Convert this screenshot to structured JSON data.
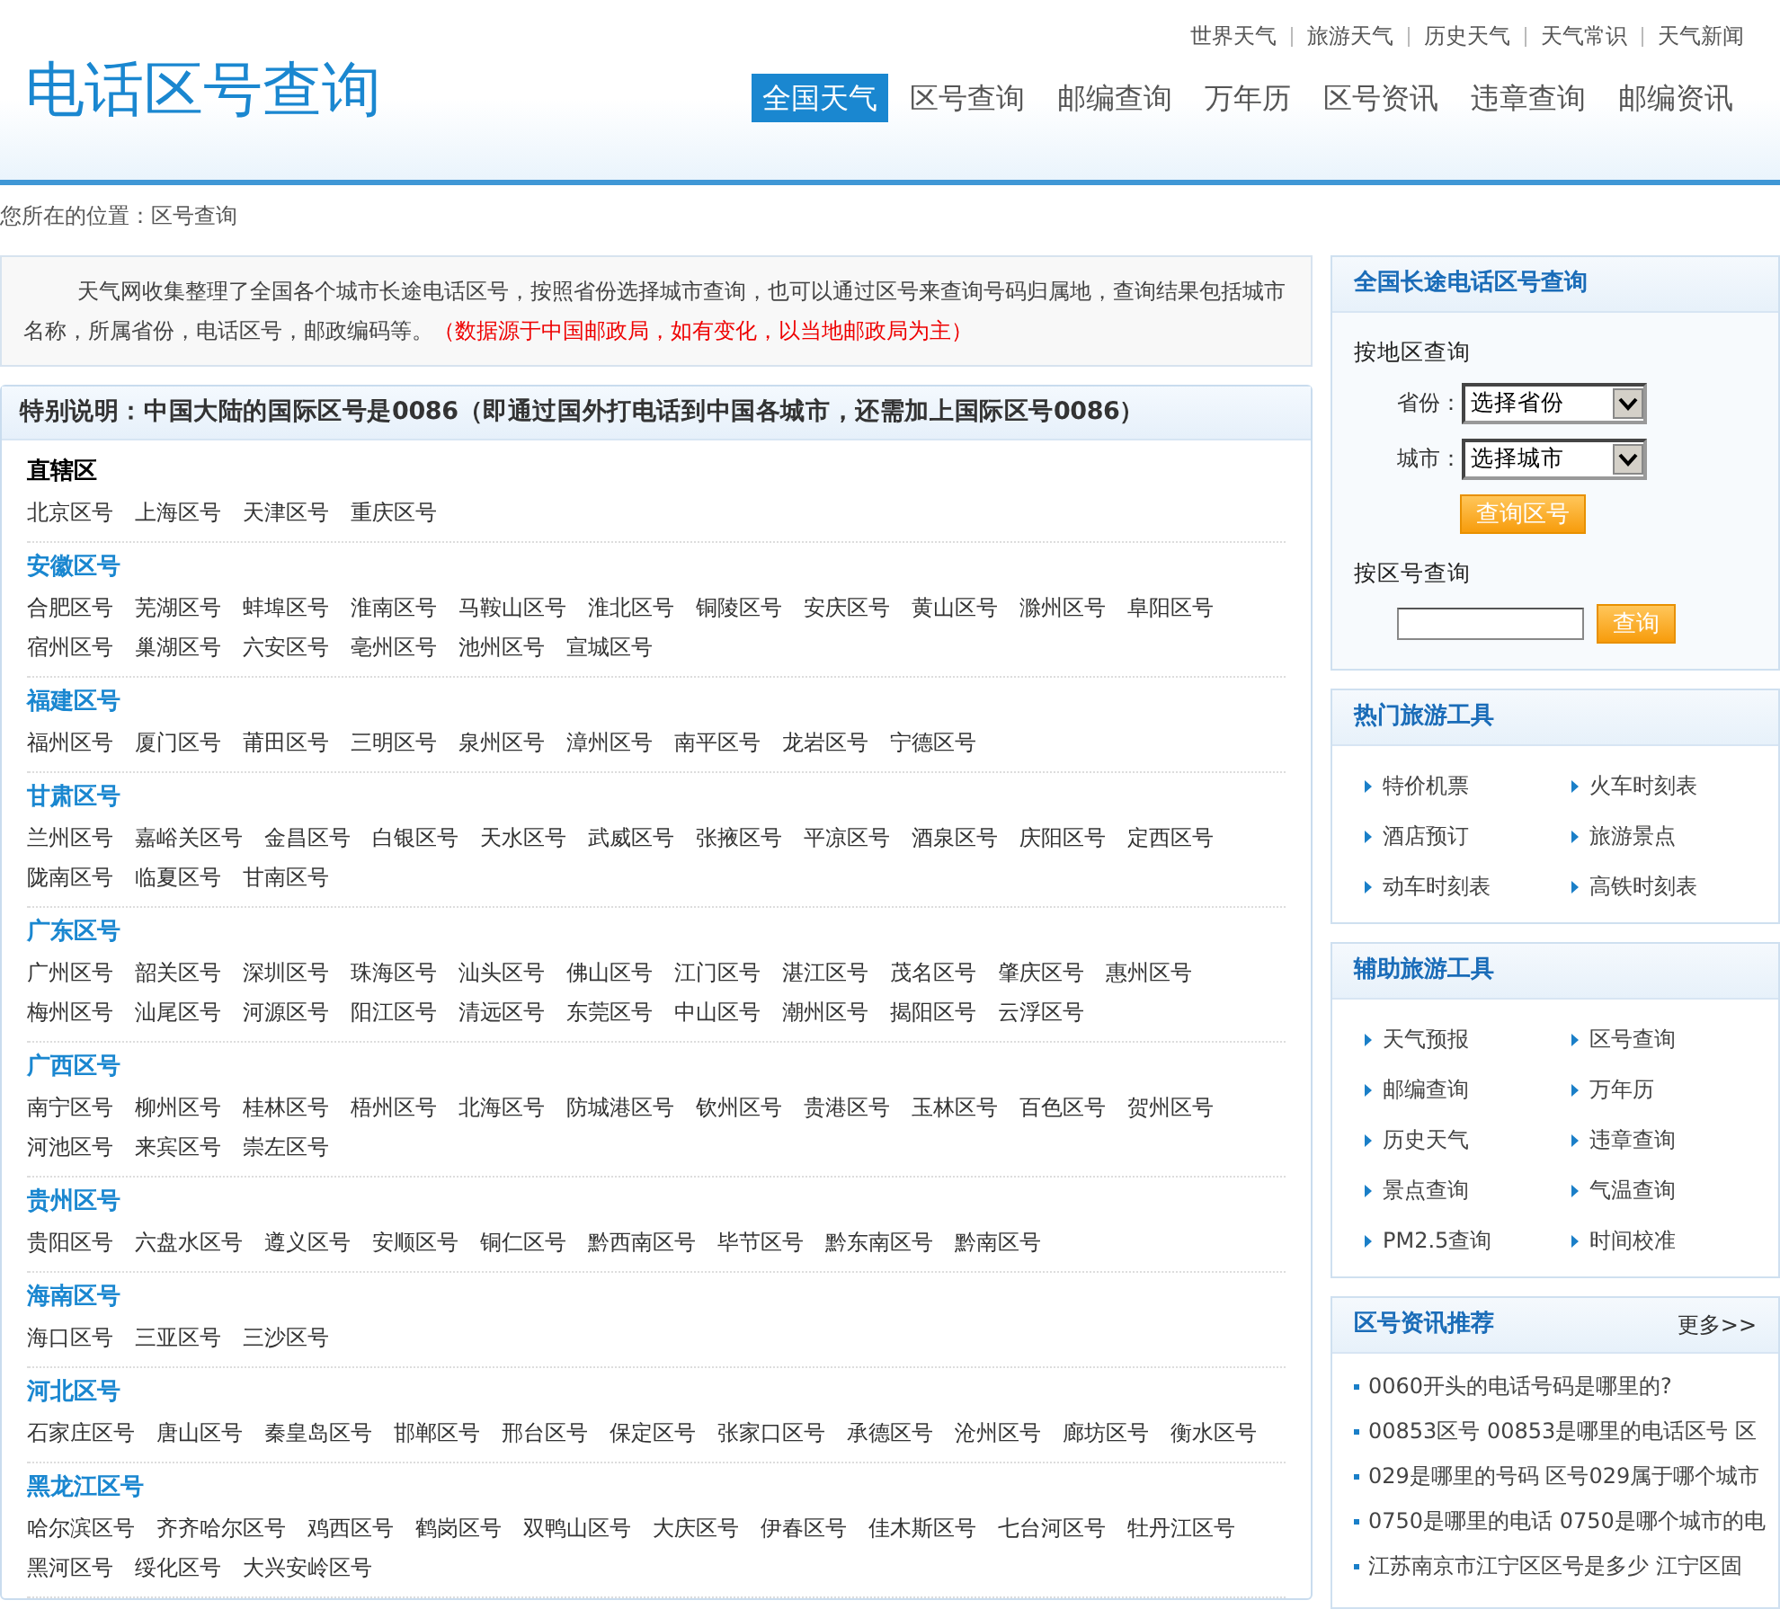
{
  "header": {
    "logo": "电话区号查询",
    "top_links": [
      "世界天气",
      "旅游天气",
      "历史天气",
      "天气常识",
      "天气新闻"
    ],
    "nav": [
      {
        "label": "全国天气",
        "selected": true
      },
      {
        "label": "区号查询",
        "selected": false
      },
      {
        "label": "邮编查询",
        "selected": false
      },
      {
        "label": "万年历",
        "selected": false
      },
      {
        "label": "区号资讯",
        "selected": false
      },
      {
        "label": "违章查询",
        "selected": false
      },
      {
        "label": "邮编资讯",
        "selected": false
      }
    ]
  },
  "breadcrumb": {
    "label": "您所在的位置：",
    "link": "区号查询"
  },
  "intro": {
    "text": "天气网收集整理了全国各个城市长途电话区号，按照省份选择城市查询，也可以通过区号来查询号码归属地，查询结果包括城市名称，所属省份，电话区号，邮政编码等。",
    "note": "（数据源于中国邮政局，如有变化，以当地邮政局为主）"
  },
  "notice": {
    "title": "特别说明：中国大陆的国际区号是0086（即通过国外打电话到中国各城市，还需加上国际区号0086）",
    "groups": [
      {
        "kind": "heading",
        "title": "直辖区",
        "links": [
          "北京区号",
          "上海区号",
          "天津区号",
          "重庆区号"
        ]
      },
      {
        "kind": "link",
        "title": "安徽区号",
        "links": [
          "合肥区号",
          "芜湖区号",
          "蚌埠区号",
          "淮南区号",
          "马鞍山区号",
          "淮北区号",
          "铜陵区号",
          "安庆区号",
          "黄山区号",
          "滁州区号",
          "阜阳区号",
          "宿州区号",
          "巢湖区号",
          "六安区号",
          "亳州区号",
          "池州区号",
          "宣城区号"
        ]
      },
      {
        "kind": "link",
        "title": "福建区号",
        "links": [
          "福州区号",
          "厦门区号",
          "莆田区号",
          "三明区号",
          "泉州区号",
          "漳州区号",
          "南平区号",
          "龙岩区号",
          "宁德区号"
        ]
      },
      {
        "kind": "link",
        "title": "甘肃区号",
        "links": [
          "兰州区号",
          "嘉峪关区号",
          "金昌区号",
          "白银区号",
          "天水区号",
          "武威区号",
          "张掖区号",
          "平凉区号",
          "酒泉区号",
          "庆阳区号",
          "定西区号",
          "陇南区号",
          "临夏区号",
          "甘南区号"
        ]
      },
      {
        "kind": "link",
        "title": "广东区号",
        "links": [
          "广州区号",
          "韶关区号",
          "深圳区号",
          "珠海区号",
          "汕头区号",
          "佛山区号",
          "江门区号",
          "湛江区号",
          "茂名区号",
          "肇庆区号",
          "惠州区号",
          "梅州区号",
          "汕尾区号",
          "河源区号",
          "阳江区号",
          "清远区号",
          "东莞区号",
          "中山区号",
          "潮州区号",
          "揭阳区号",
          "云浮区号"
        ]
      },
      {
        "kind": "link",
        "title": "广西区号",
        "links": [
          "南宁区号",
          "柳州区号",
          "桂林区号",
          "梧州区号",
          "北海区号",
          "防城港区号",
          "钦州区号",
          "贵港区号",
          "玉林区号",
          "百色区号",
          "贺州区号",
          "河池区号",
          "来宾区号",
          "崇左区号"
        ]
      },
      {
        "kind": "link",
        "title": "贵州区号",
        "links": [
          "贵阳区号",
          "六盘水区号",
          "遵义区号",
          "安顺区号",
          "铜仁区号",
          "黔西南区号",
          "毕节区号",
          "黔东南区号",
          "黔南区号"
        ]
      },
      {
        "kind": "link",
        "title": "海南区号",
        "links": [
          "海口区号",
          "三亚区号",
          "三沙区号"
        ]
      },
      {
        "kind": "link",
        "title": "河北区号",
        "links": [
          "石家庄区号",
          "唐山区号",
          "秦皇岛区号",
          "邯郸区号",
          "邢台区号",
          "保定区号",
          "张家口区号",
          "承德区号",
          "沧州区号",
          "廊坊区号",
          "衡水区号"
        ]
      },
      {
        "kind": "link",
        "title": "黑龙江区号",
        "links": [
          "哈尔滨区号",
          "齐齐哈尔区号",
          "鸡西区号",
          "鹤岗区号",
          "双鸭山区号",
          "大庆区号",
          "伊春区号",
          "佳木斯区号",
          "七台河区号",
          "牡丹江区号",
          "黑河区号",
          "绥化区号",
          "大兴安岭区号"
        ]
      }
    ]
  },
  "query_panel": {
    "title": "全国长途电话区号查询",
    "by_region": "按地区查询",
    "province_label": "省份：",
    "province_value": "选择省份",
    "city_label": "城市：",
    "city_value": "选择城市",
    "region_button": "查询区号",
    "by_code": "按区号查询",
    "code_button": "查询"
  },
  "hot_tools": {
    "title": "热门旅游工具",
    "items": [
      "特价机票",
      "火车时刻表",
      "酒店预订",
      "旅游景点",
      "动车时刻表",
      "高铁时刻表"
    ]
  },
  "aux_tools": {
    "title": "辅助旅游工具",
    "items": [
      "天气预报",
      "区号查询",
      "邮编查询",
      "万年历",
      "历史天气",
      "违章查询",
      "景点查询",
      "气温查询",
      "PM2.5查询",
      "时间校准"
    ]
  },
  "news": {
    "title": "区号资讯推荐",
    "more": "更多>>",
    "items": [
      "0060开头的电话号码是哪里的?",
      "00853区号 00853是哪里的电话区号 区",
      "029是哪里的号码 区号029属于哪个城市",
      "0750是哪里的电话 0750是哪个城市的电",
      "江苏南京市江宁区区号是多少 江宁区固"
    ]
  }
}
